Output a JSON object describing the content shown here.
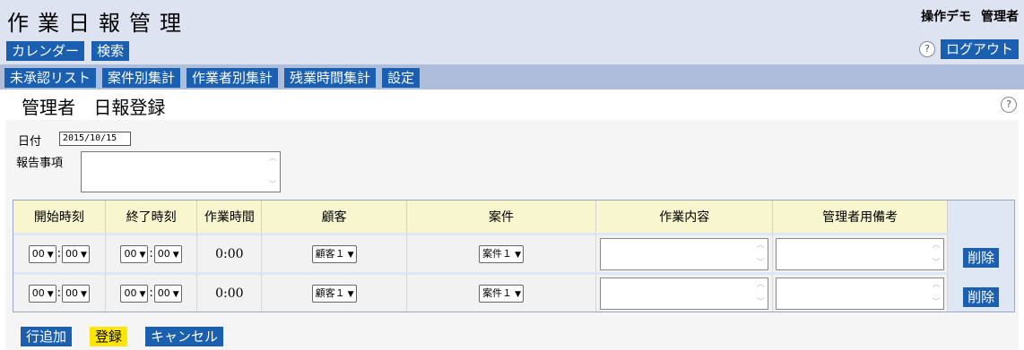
{
  "header": {
    "title": "作業日報管理",
    "user_name": "操作デモ",
    "user_role": "管理者"
  },
  "nav_primary": [
    "カレンダー",
    "検索"
  ],
  "logout_label": "ログアウト",
  "nav_secondary": [
    "未承認リスト",
    "案件別集計",
    "作業者別集計",
    "残業時間集計",
    "設定"
  ],
  "page": {
    "title_role": "管理者",
    "title_action": "日報登録"
  },
  "form": {
    "date_label": "日付",
    "date_value": "2015/10/15",
    "report_label": "報告事項",
    "report_value": ""
  },
  "table": {
    "headers": [
      "開始時刻",
      "終了時刻",
      "作業時間",
      "顧客",
      "案件",
      "作業内容",
      "管理者用備考"
    ],
    "rows": [
      {
        "start_h": "00",
        "start_m": "00",
        "end_h": "00",
        "end_m": "00",
        "duration": "0:00",
        "customer": "顧客１",
        "project": "案件１",
        "work": "",
        "admin_note": "",
        "delete_label": "削除"
      },
      {
        "start_h": "00",
        "start_m": "00",
        "end_h": "00",
        "end_m": "00",
        "duration": "0:00",
        "customer": "顧客１",
        "project": "案件１",
        "work": "",
        "admin_note": "",
        "delete_label": "削除"
      }
    ]
  },
  "actions": {
    "add_row": "行追加",
    "register": "登録",
    "cancel": "キャンセル"
  },
  "icons": {
    "help": "question-circle-icon",
    "dropdown": "chevron-down-icon"
  },
  "colors": {
    "button_blue": "#1a5fb0",
    "button_yellow": "#ffe600",
    "header_bg": "#dde3f0",
    "nav2_bg": "#aebdd9",
    "th_bg": "#f8f6cf"
  }
}
